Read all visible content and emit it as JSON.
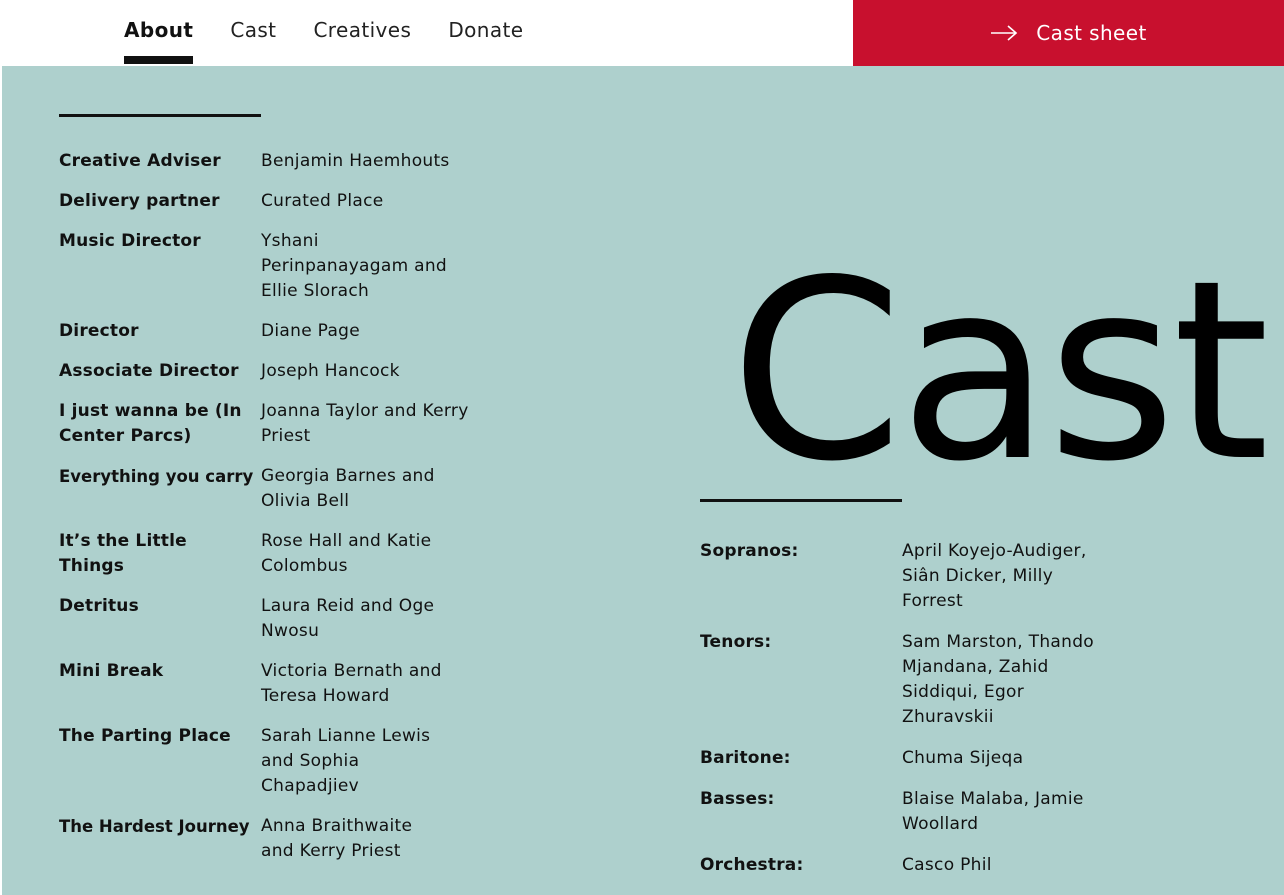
{
  "nav": {
    "tabs": [
      {
        "label": "About",
        "active": true
      },
      {
        "label": "Cast",
        "active": false
      },
      {
        "label": "Creatives",
        "active": false
      },
      {
        "label": "Donate",
        "active": false
      }
    ],
    "cta_label": "Cast sheet",
    "cta_icon": "arrow-right-icon"
  },
  "colors": {
    "accent": "#c8102e",
    "panel": "#aed0cd",
    "text": "#111111"
  },
  "credits": [
    {
      "role": "Creative Adviser",
      "name": "Benjamin Haemhouts"
    },
    {
      "role": "Delivery partner",
      "name": "Curated Place"
    },
    {
      "role": "Music Director",
      "name": "Yshani Perinpanayagam and Ellie Slorach"
    },
    {
      "role": "Director",
      "name": "Diane Page"
    },
    {
      "role": "Associate Director",
      "name": "Joseph Hancock"
    },
    {
      "role": "I just wanna be (In Center Parcs)",
      "name": "Joanna Taylor and Kerry Priest"
    },
    {
      "role": "Everything you carry",
      "name": "Georgia Barnes and Olivia Bell"
    },
    {
      "role": "It’s the Little Things",
      "name": "Rose Hall and Katie Colombus"
    },
    {
      "role": "Detritus",
      "name": "Laura Reid and Oge Nwosu"
    },
    {
      "role": "Mini Break",
      "name": "Victoria Bernath and Teresa Howard"
    },
    {
      "role": "The Parting Place",
      "name": "Sarah Lianne Lewis and Sophia Chapadjiev"
    },
    {
      "role": "The Hardest Journey",
      "name": "Anna Braithwaite and Kerry Priest"
    }
  ],
  "cast": {
    "heading": "Cast",
    "voices": [
      {
        "part": "Sopranos:",
        "names": "April Koyejo-Audiger, Siân Dicker, Milly Forrest"
      },
      {
        "part": "Tenors:",
        "names": "Sam Marston, Thando Mjandana, Zahid Siddiqui, Egor Zhuravskii"
      },
      {
        "part": "Baritone:",
        "names": "Chuma Sijeqa"
      },
      {
        "part": "Basses:",
        "names": "Blaise Malaba, Jamie Woollard"
      },
      {
        "part": "Orchestra:",
        "names": "Casco Phil"
      }
    ]
  }
}
